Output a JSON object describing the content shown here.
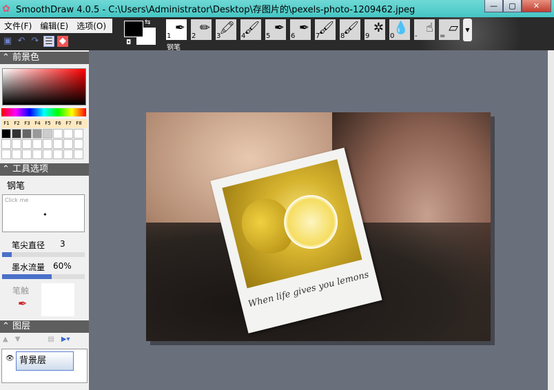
{
  "window": {
    "title": "SmoothDraw 4.0.5 - C:\\Users\\Administrator\\Desktop\\存图片的\\pexels-photo-1209462.jpeg",
    "minimize": "—",
    "maximize": "▢",
    "close": "✕"
  },
  "menu": [
    "文件(F)",
    "编辑(E)",
    "选项(O)"
  ],
  "tools": [
    {
      "key": "1",
      "icon": "pen-icon",
      "glyph": "✒"
    },
    {
      "key": "2",
      "icon": "pencil-icon",
      "glyph": "✏"
    },
    {
      "key": "3",
      "icon": "marker-icon",
      "glyph": "🖍"
    },
    {
      "key": "4",
      "icon": "brush-icon",
      "glyph": "🖌"
    },
    {
      "key": "5",
      "icon": "airbrush-icon",
      "glyph": "✒"
    },
    {
      "key": "6",
      "icon": "spray-icon",
      "glyph": "✒"
    },
    {
      "key": "7",
      "icon": "flat-brush-icon",
      "glyph": "🖌"
    },
    {
      "key": "8",
      "icon": "ink-brush-icon",
      "glyph": "🖌"
    },
    {
      "key": "9",
      "icon": "sparkle-icon",
      "glyph": "✲"
    },
    {
      "key": "0",
      "icon": "water-drop-icon",
      "glyph": "💧"
    },
    {
      "key": "-",
      "icon": "finger-smudge-icon",
      "glyph": "☝"
    },
    {
      "key": "=",
      "icon": "eraser-icon",
      "glyph": "▱"
    }
  ],
  "selected_tool_label": "钢笔",
  "panels": {
    "foreground": {
      "title": "前景色",
      "fkeys": [
        "F1",
        "F2",
        "F3",
        "F4",
        "F5",
        "F6",
        "F7",
        "F8"
      ],
      "palette": [
        "#000000",
        "#333333",
        "#666666",
        "#999999",
        "#cccccc",
        "#ffffff",
        "#ffffff",
        "#ffffff"
      ]
    },
    "tool_options": {
      "title": "工具选项",
      "tool_name": "钢笔",
      "preview_hint": "Click me",
      "tip_size_label": "笔尖直径",
      "tip_size": "3",
      "tip_size_fraction": 0.12,
      "ink_flow_label": "墨水流量",
      "ink_flow": "60%",
      "ink_flow_fraction": 0.6,
      "touch_label": "笔触"
    },
    "layers": {
      "title": "图层",
      "items": [
        {
          "name": "背景层",
          "visible": true
        }
      ]
    }
  },
  "canvas": {
    "caption": "When life gives you lemons"
  }
}
